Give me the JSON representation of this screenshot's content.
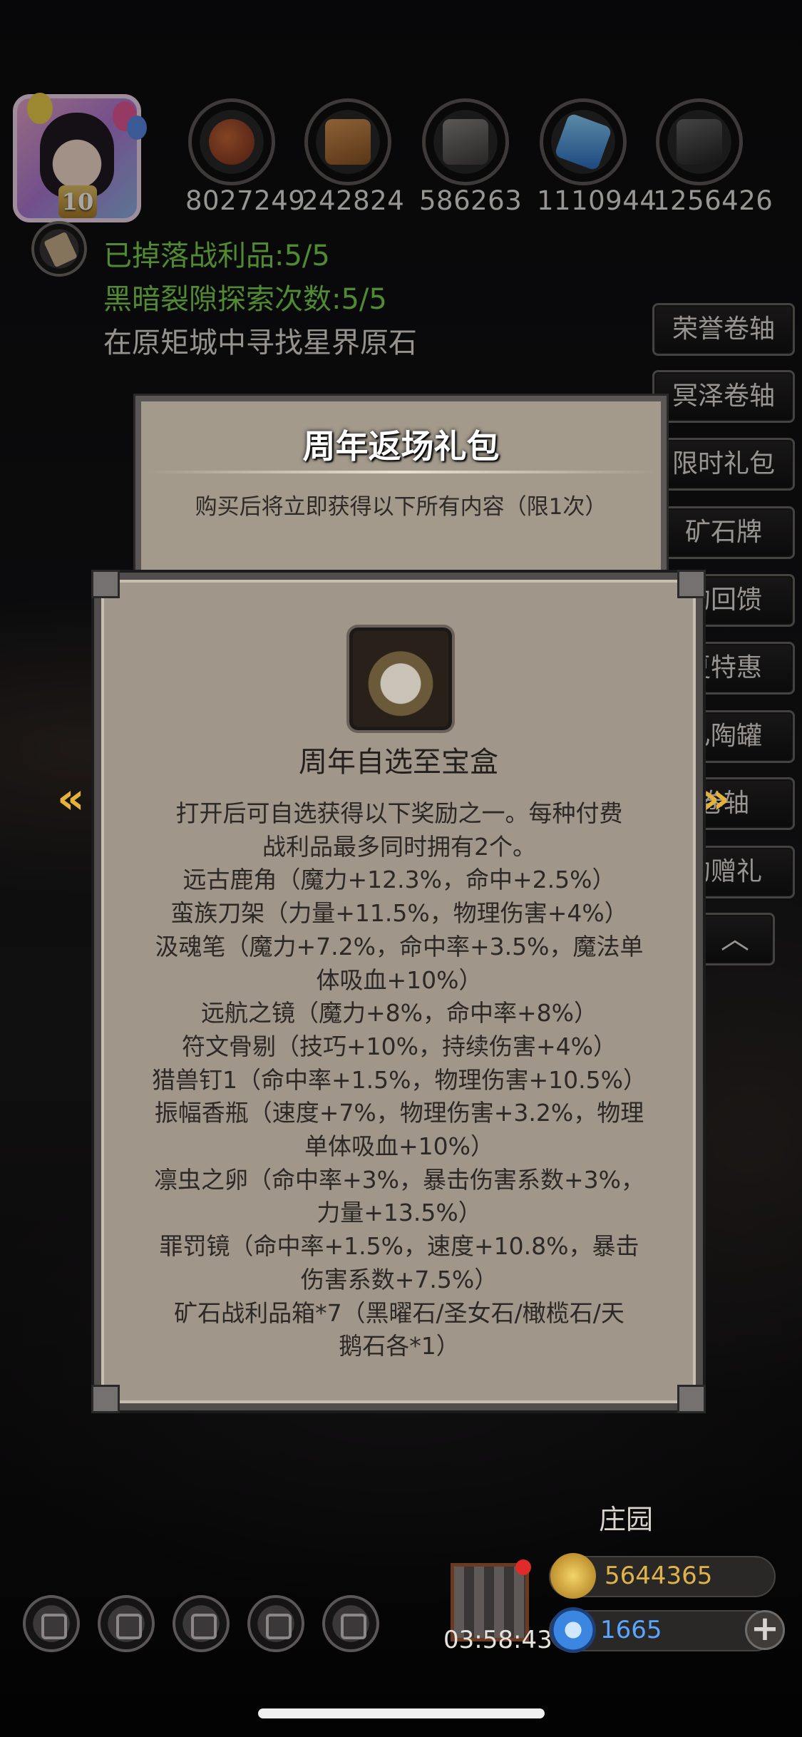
{
  "player": {
    "level": "10"
  },
  "resources": [
    {
      "icon": "meat-icon",
      "value": "8027249"
    },
    {
      "icon": "wood-icon",
      "value": "242824"
    },
    {
      "icon": "iron-icon",
      "value": "586263"
    },
    {
      "icon": "crystal-icon",
      "value": "1110944"
    },
    {
      "icon": "stone-icon",
      "value": "1256426"
    }
  ],
  "status": {
    "loot": "已掉落战利品:5/5",
    "rift": "黑暗裂隙探索次数:5/5",
    "quest": "在原矩城中寻找星界原石"
  },
  "side_menu": [
    "荣誉卷轴",
    "冥泽卷轴",
    "限时礼包",
    "矿石牌",
    "的回馈",
    "夏特惠",
    "乙陶罐",
    "卷轴",
    "的赠礼"
  ],
  "pack": {
    "title": "周年返场礼包",
    "subtitle": "购买后将立即获得以下所有内容（限1次）"
  },
  "item": {
    "name": "周年自选至宝盒",
    "description": [
      "打开后可自选获得以下奖励之一。每种付费",
      "战利品最多同时拥有2个。",
      "远古鹿角（魔力+12.3%，命中+2.5%）",
      "蛮族刀架（力量+11.5%，物理伤害+4%）",
      "汲魂笔（魔力+7.2%，命中率+3.5%，魔法单",
      "体吸血+10%）",
      "远航之镜（魔力+8%，命中率+8%）",
      "符文骨剔（技巧+10%，持续伤害+4%）",
      "猎兽钉1（命中率+1.5%，物理伤害+10.5%）",
      "振幅香瓶（速度+7%，物理伤害+3.2%，物理",
      "单体吸血+10%）",
      "凛虫之卵（命中率+3%，暴击伤害系数+3%，",
      "力量+13.5%）",
      "罪罚镜（命中率+1.5%，速度+10.8%，暴击",
      "伤害系数+7.5%）",
      "矿石战利品箱*7（黑曜石/圣女石/橄榄石/天",
      "鹅石各*1）"
    ]
  },
  "nav": {
    "prev": "«",
    "next": "»",
    "collapse": "︿"
  },
  "bottom": {
    "estate_label": "庄园",
    "gift_timer": "03:58:43",
    "gold": "5644365",
    "gems": "1665",
    "plus": "+"
  },
  "colors": {
    "status_green": "#7cd64e",
    "gold_text": "#e0b34a",
    "gem_text": "#5aa6ff",
    "panel_bg": "#a0978a"
  }
}
